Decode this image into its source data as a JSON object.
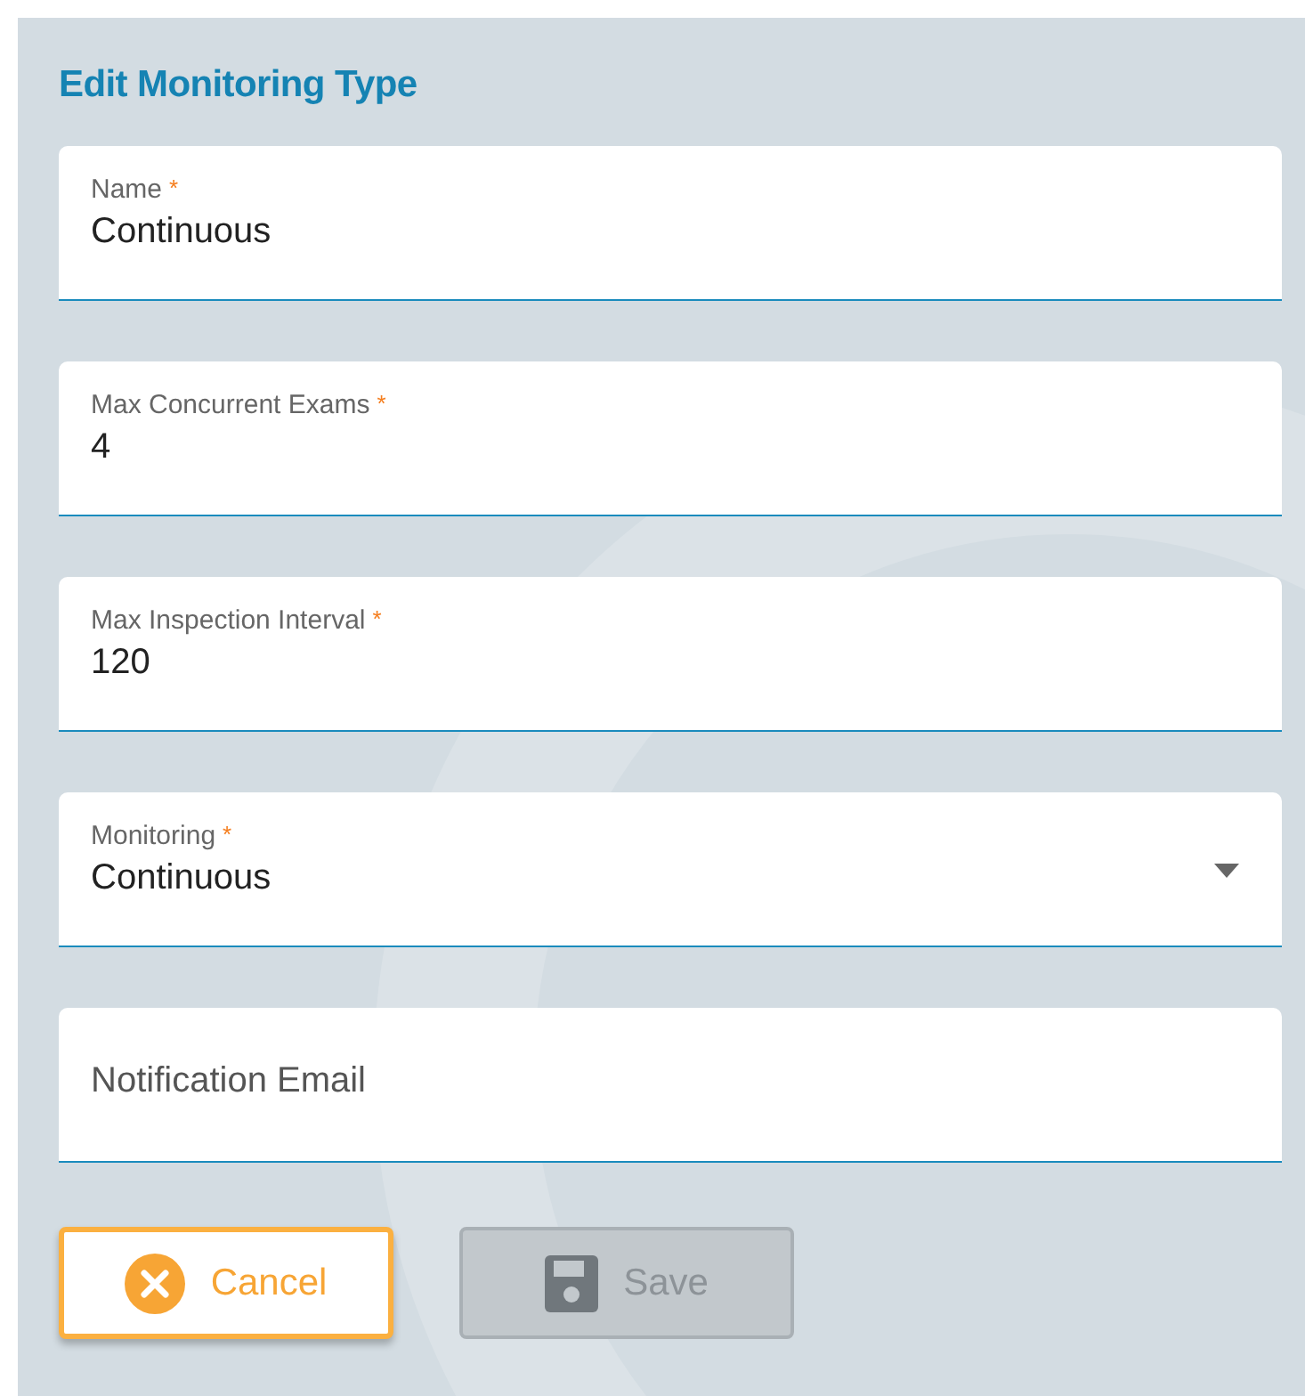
{
  "title": "Edit Monitoring Type",
  "fields": [
    {
      "kind": "text",
      "label": "Name",
      "required_mark": "*",
      "value": "Continuous"
    },
    {
      "kind": "text",
      "label": "Max Concurrent Exams",
      "required_mark": "*",
      "value": "4"
    },
    {
      "kind": "text",
      "label": "Max Inspection Interval",
      "required_mark": "*",
      "value": "120"
    },
    {
      "kind": "select",
      "label": "Monitoring",
      "required_mark": "*",
      "value": "Continuous"
    },
    {
      "kind": "text",
      "placeholder": "Notification Email"
    }
  ],
  "buttons": [
    {
      "kind": "cancel",
      "label": "Cancel",
      "disabled": false
    },
    {
      "kind": "save",
      "label": "Save",
      "disabled": true
    }
  ]
}
